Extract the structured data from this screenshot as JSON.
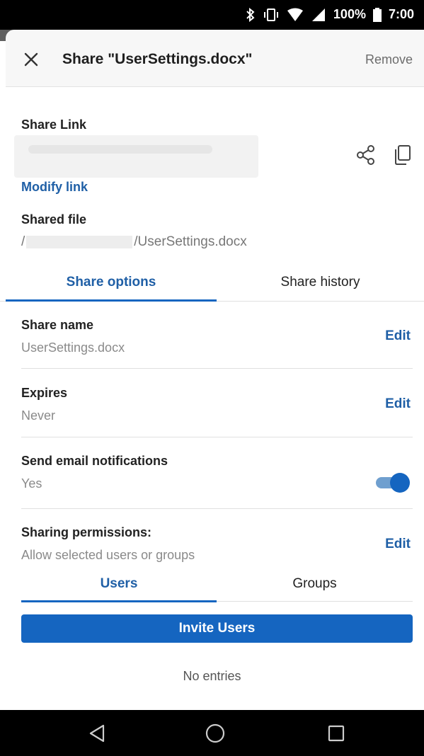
{
  "status_bar": {
    "battery": "100%",
    "time": "7:00",
    "icons": [
      "bluetooth-icon",
      "vibrate-icon",
      "wifi-icon",
      "signal-icon",
      "battery-icon"
    ]
  },
  "header": {
    "close_icon": "close-icon",
    "title": "Share \"UserSettings.docx\"",
    "remove_label": "Remove"
  },
  "share_link": {
    "label": "Share Link",
    "modify_label": "Modify link",
    "actions": [
      "share-icon",
      "copy-icon"
    ]
  },
  "shared_file": {
    "label": "Shared file",
    "path_prefix": "/",
    "path_suffix": "/UserSettings.docx"
  },
  "tabs": [
    {
      "label": "Share options",
      "active": true
    },
    {
      "label": "Share history",
      "active": false
    }
  ],
  "options": {
    "share_name": {
      "label": "Share name",
      "value": "UserSettings.docx",
      "action": "Edit"
    },
    "expires": {
      "label": "Expires",
      "value": "Never",
      "action": "Edit"
    },
    "email": {
      "label": "Send email notifications",
      "value": "Yes",
      "toggle": true
    },
    "permissions": {
      "label": "Sharing permissions:",
      "value": "Allow selected users or groups",
      "action": "Edit"
    }
  },
  "sub_tabs": [
    {
      "label": "Users",
      "active": true
    },
    {
      "label": "Groups",
      "active": false
    }
  ],
  "invite_label": "Invite Users",
  "empty_label": "No entries",
  "colors": {
    "accent": "#1565c0",
    "link": "#1f5fa6"
  }
}
